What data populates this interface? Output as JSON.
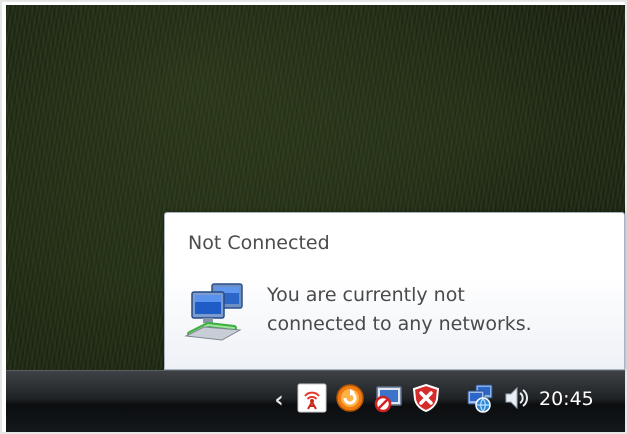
{
  "balloon": {
    "title": "Not Connected",
    "message_line1": "You are currently not",
    "message_line2": "connected to any networks.",
    "icon": "network-computers-icon"
  },
  "taskbar": {
    "clock": "20:45",
    "tray_icons": [
      "show-hidden-icons-chevron",
      "wireless-signal-icon",
      "orange-update-icon",
      "screen-blocked-icon",
      "security-shield-icon",
      "network-status-icon",
      "volume-icon"
    ]
  },
  "colors": {
    "taskbar": "#1f2326",
    "balloon_background": "#ffffff",
    "balloon_text": "#4a4a4a",
    "desktop": "#1d2416"
  }
}
